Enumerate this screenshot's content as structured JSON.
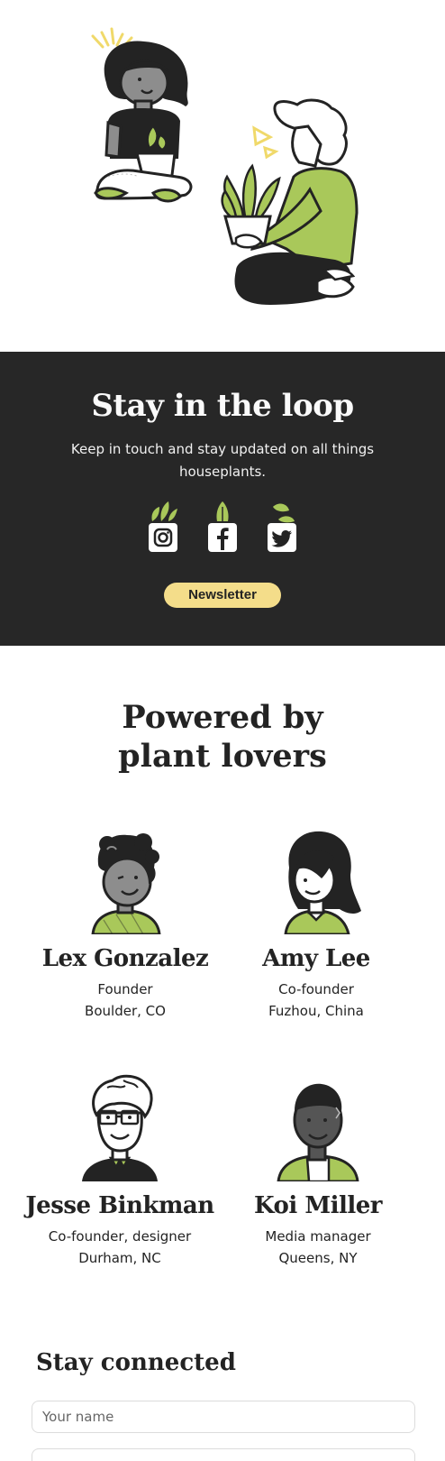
{
  "hero": {
    "illustration": "two people with houseplants"
  },
  "loop": {
    "title": "Stay in the loop",
    "subtitle": "Keep in touch and stay updated on all things houseplants.",
    "socials": [
      {
        "icon": "instagram-icon"
      },
      {
        "icon": "facebook-icon"
      },
      {
        "icon": "twitter-icon"
      }
    ],
    "newsletter_label": "Newsletter",
    "colors": {
      "background": "#272727",
      "button": "#f4dd8a",
      "accent": "#a9c85a"
    }
  },
  "team": {
    "title": "Powered by plant lovers",
    "members": [
      {
        "name": "Lex Gonzalez",
        "role": "Founder",
        "location": "Boulder, CO"
      },
      {
        "name": "Amy Lee",
        "role": "Co-founder",
        "location": "Fuzhou, China"
      },
      {
        "name": "Jesse Binkman",
        "role": "Co-founder, designer",
        "location": "Durham, NC"
      },
      {
        "name": "Koi Miller",
        "role": "Media manager",
        "location": "Queens, NY"
      }
    ]
  },
  "connect": {
    "title": "Stay connected",
    "name_placeholder": "Your name",
    "email_placeholder": ""
  }
}
